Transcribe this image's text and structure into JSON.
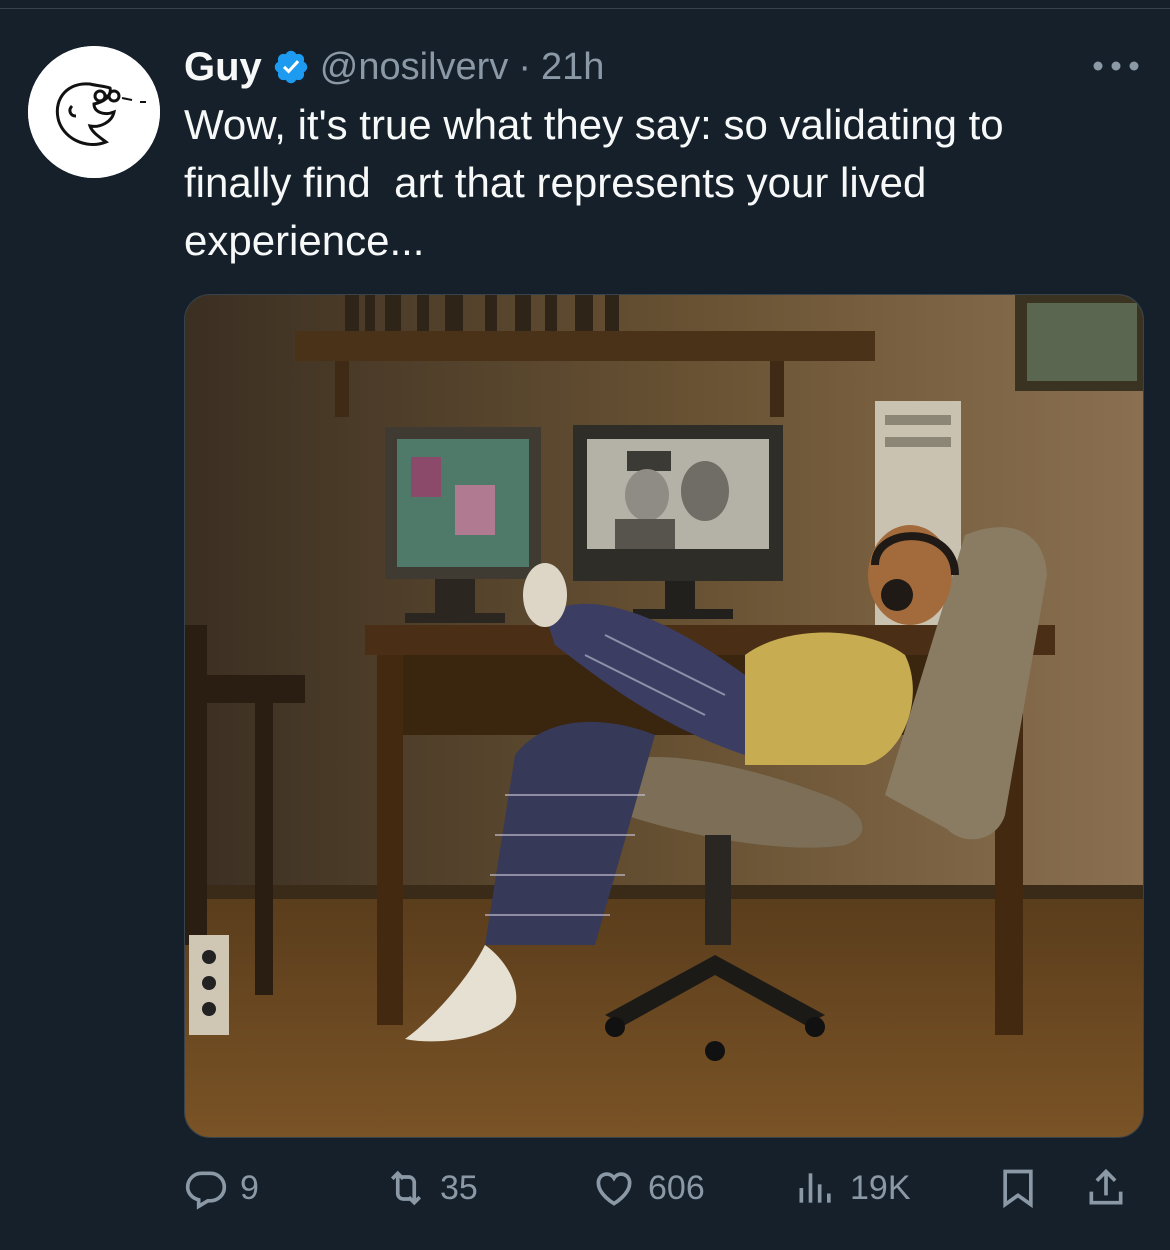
{
  "tweet": {
    "display_name": "Guy",
    "handle": "@nosilverv",
    "separator": "·",
    "time": "21h",
    "text": "Wow, it's true what they say: so validating to\nfinally find  art that represents your lived\nexperience...",
    "verified_color": "#1d9bf0"
  },
  "actions": {
    "replies": "9",
    "reposts": "35",
    "likes": "606",
    "views": "19K"
  },
  "icons": {
    "avatar": "doodle-face-avatar",
    "verified": "verified-badge-icon",
    "more": "more-dots-icon",
    "reply": "reply-icon",
    "repost": "repost-icon",
    "like": "heart-icon",
    "views": "views-bars-icon",
    "bookmark": "bookmark-icon",
    "share": "share-icon"
  },
  "colors": {
    "background": "#15202b",
    "secondary_text": "#8b98a5",
    "primary_text": "#f7f9f9"
  }
}
